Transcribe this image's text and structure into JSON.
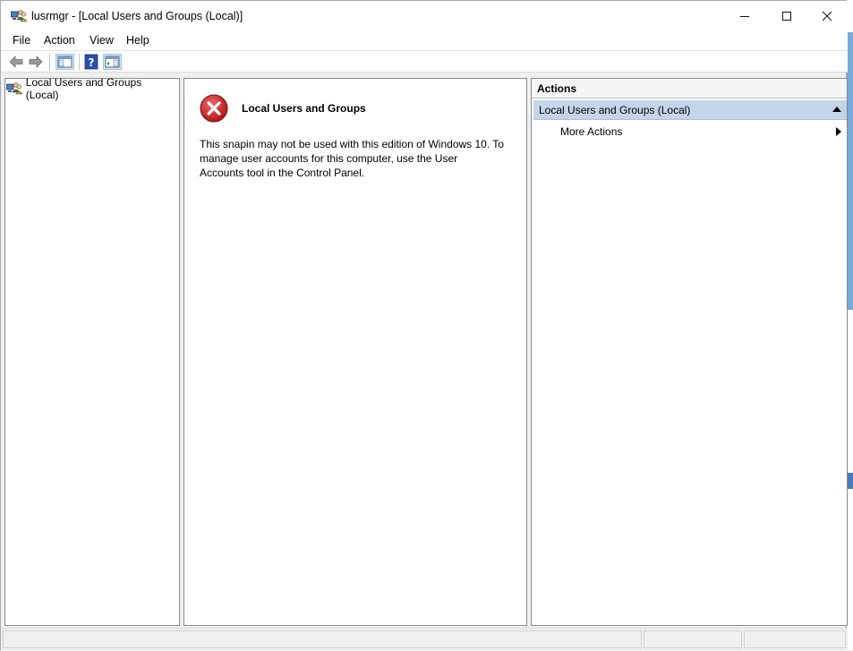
{
  "window": {
    "title": "lusrmgr - [Local Users and Groups (Local)]",
    "controls": [
      "minimize-icon",
      "maximize-icon",
      "close-icon"
    ]
  },
  "menu": {
    "file": "File",
    "action": "Action",
    "view": "View",
    "help": "Help"
  },
  "toolbar": {
    "buttons": [
      "back-arrow-icon",
      "forward-arrow-icon",
      "show-hide-console-tree-icon",
      "help-icon",
      "show-hide-action-pane-icon"
    ]
  },
  "tree": {
    "root_label": "Local Users and Groups (Local)"
  },
  "center": {
    "error_title": "Local Users and Groups",
    "error_message": "This snapin may not be used with this edition of Windows 10. To manage user accounts for this computer, use the User Accounts tool in the Control Panel."
  },
  "actions": {
    "header": "Actions",
    "section_label": "Local Users and Groups (Local)",
    "more_actions": "More Actions"
  },
  "colors": {
    "selection_blue": "#c4d5ea",
    "error_red": "#c42b2b"
  }
}
